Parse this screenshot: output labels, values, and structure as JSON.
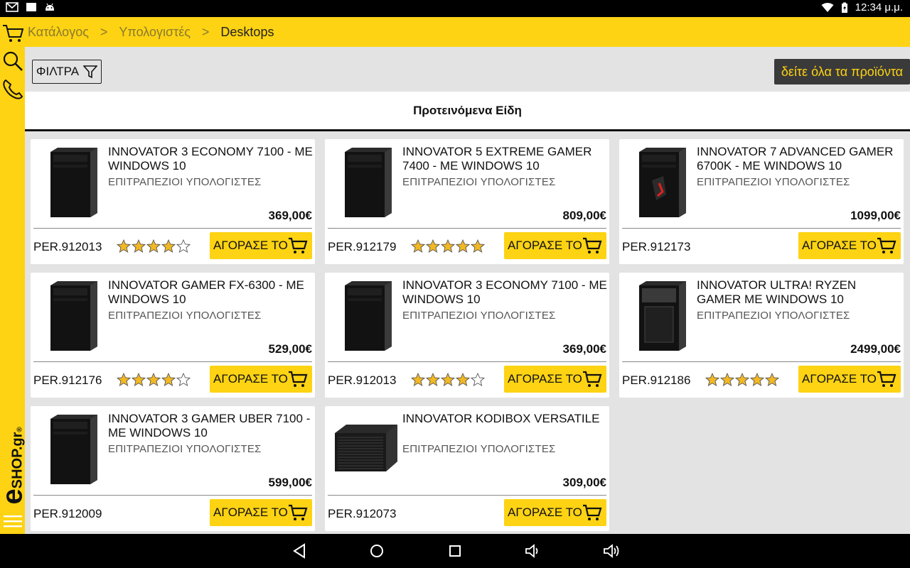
{
  "status": {
    "time": "12:34 μ.μ."
  },
  "breadcrumb": {
    "items": [
      "Κατάλογος",
      "Υπολογιστές"
    ],
    "separator": ">",
    "current": "Desktops"
  },
  "toolbar": {
    "filter_label": "ΦΙΛΤΡΑ",
    "all_products_label": "δείτε όλα τα προϊόντα"
  },
  "section": {
    "title": "Προτεινόμενα Είδη"
  },
  "sidebar": {
    "logo_e": "e",
    "logo_text": "SHOP.gr",
    "logo_reg": "®"
  },
  "colors": {
    "accent": "#fdd313",
    "dark": "#3a3a3a",
    "background": "#e3e3e3",
    "star": "#f2b824"
  },
  "buy_label": "ΑΓΟΡΑΣΕ ΤΟ",
  "products": [
    {
      "name": "INNOVATOR 3 ECONOMY 7100 - ME WINDOWS 10",
      "category": "ΕΠΙΤΡΑΠΕΖΙΟΙ ΥΠΟΛΟΓΙΣΤΕΣ",
      "price": "369,00€",
      "sku": "PER.912013",
      "rating": 4,
      "image": "tower-black-icon"
    },
    {
      "name": "INNOVATOR 5 EXTREME GAMER 7400 - ME WINDOWS 10",
      "category": "ΕΠΙΤΡΑΠΕΖΙΟΙ ΥΠΟΛΟΓΙΣΤΕΣ",
      "price": "809,00€",
      "sku": "PER.912179",
      "rating": 5,
      "image": "tower-black-icon"
    },
    {
      "name": "INNOVATOR 7 ADVANCED GAMER 6700K - ME WINDOWS 10",
      "category": "ΕΠΙΤΡΑΠΕΖΙΟΙ ΥΠΟΛΟΓΙΣΤΕΣ",
      "price": "1099,00€",
      "sku": "PER.912173",
      "rating": 0,
      "image": "tower-gamer-red-icon"
    },
    {
      "name": "INNOVATOR GAMER FX-6300 - ME WINDOWS 10",
      "category": "ΕΠΙΤΡΑΠΕΖΙΟΙ ΥΠΟΛΟΓΙΣΤΕΣ",
      "price": "529,00€",
      "sku": "PER.912176",
      "rating": 4,
      "image": "tower-black-icon"
    },
    {
      "name": "INNOVATOR 3 ECONOMY 7100 - ME WINDOWS 10",
      "category": "ΕΠΙΤΡΑΠΕΖΙΟΙ ΥΠΟΛΟΓΙΣΤΕΣ",
      "price": "369,00€",
      "sku": "PER.912013",
      "rating": 4,
      "image": "tower-black-icon"
    },
    {
      "name": "INNOVATOR ULTRA! RYZEN GAMER ME WINDOWS 10",
      "category": "ΕΠΙΤΡΑΠΕΖΙΟΙ ΥΠΟΛΟΓΙΣΤΕΣ",
      "price": "2499,00€",
      "sku": "PER.912186",
      "rating": 5,
      "image": "tower-gamer-icon"
    },
    {
      "name": "INNOVATOR 3 GAMER UBER 7100 - ME WINDOWS 10",
      "category": "ΕΠΙΤΡΑΠΕΖΙΟΙ ΥΠΟΛΟΓΙΣΤΕΣ",
      "price": "599,00€",
      "sku": "PER.912009",
      "rating": 0,
      "image": "tower-black-icon"
    },
    {
      "name": "INNOVATOR KODIBOX VERSATILE",
      "category": "ΕΠΙΤΡΑΠΕΖΙΟΙ ΥΠΟΛΟΓΙΣΤΕΣ",
      "price": "309,00€",
      "sku": "PER.912073",
      "rating": 0,
      "image": "mini-cube-icon"
    }
  ]
}
